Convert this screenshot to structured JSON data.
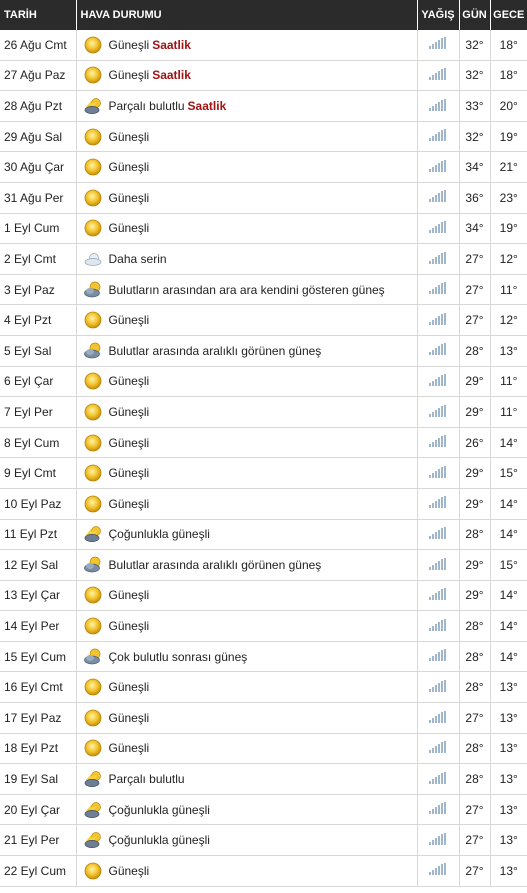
{
  "header": {
    "date": "TARİH",
    "condition": "HAVA DURUMU",
    "rain": "YAĞIŞ",
    "day": "GÜN",
    "night": "GECE"
  },
  "hourly_label": "Saatlik",
  "rows": [
    {
      "date": "26 Ağu Cmt",
      "icon": "sun",
      "condition": "Güneşli",
      "hourly": true,
      "day": "32°",
      "night": "18°"
    },
    {
      "date": "27 Ağu Paz",
      "icon": "sun",
      "condition": "Güneşli",
      "hourly": true,
      "day": "32°",
      "night": "18°"
    },
    {
      "date": "28 Ağu Pzt",
      "icon": "sun-cloud-dark",
      "condition": "Parçalı bulutlu",
      "hourly": true,
      "day": "33°",
      "night": "20°"
    },
    {
      "date": "29 Ağu Sal",
      "icon": "sun",
      "condition": "Güneşli",
      "hourly": false,
      "day": "32°",
      "night": "19°"
    },
    {
      "date": "30 Ağu Çar",
      "icon": "sun",
      "condition": "Güneşli",
      "hourly": false,
      "day": "34°",
      "night": "21°"
    },
    {
      "date": "31 Ağu Per",
      "icon": "sun",
      "condition": "Güneşli",
      "hourly": false,
      "day": "36°",
      "night": "23°"
    },
    {
      "date": "1 Eyl Cum",
      "icon": "sun",
      "condition": "Güneşli",
      "hourly": false,
      "day": "34°",
      "night": "19°"
    },
    {
      "date": "2 Eyl Cmt",
      "icon": "cloud",
      "condition": "Daha serin",
      "hourly": false,
      "day": "27°",
      "night": "12°"
    },
    {
      "date": "3 Eyl Paz",
      "icon": "cloud-sun",
      "condition": "Bulutların arasından ara ara kendini gösteren güneş",
      "hourly": false,
      "day": "27°",
      "night": "11°"
    },
    {
      "date": "4 Eyl Pzt",
      "icon": "sun",
      "condition": "Güneşli",
      "hourly": false,
      "day": "27°",
      "night": "12°"
    },
    {
      "date": "5 Eyl Sal",
      "icon": "cloud-sun",
      "condition": "Bulutlar arasında aralıklı görünen güneş",
      "hourly": false,
      "day": "28°",
      "night": "13°"
    },
    {
      "date": "6 Eyl Çar",
      "icon": "sun",
      "condition": "Güneşli",
      "hourly": false,
      "day": "29°",
      "night": "11°"
    },
    {
      "date": "7 Eyl Per",
      "icon": "sun",
      "condition": "Güneşli",
      "hourly": false,
      "day": "29°",
      "night": "11°"
    },
    {
      "date": "8 Eyl Cum",
      "icon": "sun",
      "condition": "Güneşli",
      "hourly": false,
      "day": "26°",
      "night": "14°"
    },
    {
      "date": "9 Eyl Cmt",
      "icon": "sun",
      "condition": "Güneşli",
      "hourly": false,
      "day": "29°",
      "night": "15°"
    },
    {
      "date": "10 Eyl Paz",
      "icon": "sun",
      "condition": "Güneşli",
      "hourly": false,
      "day": "29°",
      "night": "14°"
    },
    {
      "date": "11 Eyl Pzt",
      "icon": "sun-cloud-dark",
      "condition": "Çoğunlukla güneşli",
      "hourly": false,
      "day": "28°",
      "night": "14°"
    },
    {
      "date": "12 Eyl Sal",
      "icon": "cloud-sun",
      "condition": "Bulutlar arasında aralıklı görünen güneş",
      "hourly": false,
      "day": "29°",
      "night": "15°"
    },
    {
      "date": "13 Eyl Çar",
      "icon": "sun",
      "condition": "Güneşli",
      "hourly": false,
      "day": "29°",
      "night": "14°"
    },
    {
      "date": "14 Eyl Per",
      "icon": "sun",
      "condition": "Güneşli",
      "hourly": false,
      "day": "28°",
      "night": "14°"
    },
    {
      "date": "15 Eyl Cum",
      "icon": "cloud-sun",
      "condition": "Çok bulutlu sonrası güneş",
      "hourly": false,
      "day": "28°",
      "night": "14°"
    },
    {
      "date": "16 Eyl Cmt",
      "icon": "sun",
      "condition": "Güneşli",
      "hourly": false,
      "day": "28°",
      "night": "13°"
    },
    {
      "date": "17 Eyl Paz",
      "icon": "sun",
      "condition": "Güneşli",
      "hourly": false,
      "day": "27°",
      "night": "13°"
    },
    {
      "date": "18 Eyl Pzt",
      "icon": "sun",
      "condition": "Güneşli",
      "hourly": false,
      "day": "28°",
      "night": "13°"
    },
    {
      "date": "19 Eyl Sal",
      "icon": "sun-cloud-dark",
      "condition": "Parçalı bulutlu",
      "hourly": false,
      "day": "28°",
      "night": "13°"
    },
    {
      "date": "20 Eyl Çar",
      "icon": "sun-cloud-dark",
      "condition": "Çoğunlukla güneşli",
      "hourly": false,
      "day": "27°",
      "night": "13°"
    },
    {
      "date": "21 Eyl Per",
      "icon": "sun-cloud-dark",
      "condition": "Çoğunlukla güneşli",
      "hourly": false,
      "day": "27°",
      "night": "13°"
    },
    {
      "date": "22 Eyl Cum",
      "icon": "sun",
      "condition": "Güneşli",
      "hourly": false,
      "day": "27°",
      "night": "13°"
    }
  ]
}
